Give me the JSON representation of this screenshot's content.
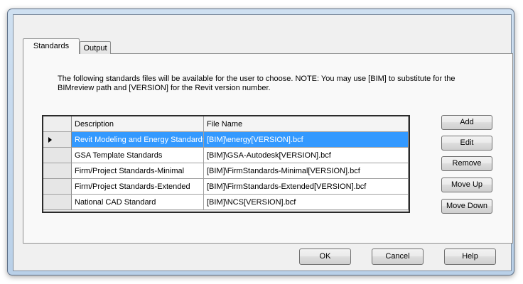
{
  "tabs": [
    {
      "label": "Standards"
    },
    {
      "label": "Output"
    }
  ],
  "note": "The following standards files will be available for the user to choose.  NOTE:  You may use [BIM] to substitute for the BIMreview path and [VERSION] for the Revit version number.",
  "grid": {
    "columns": [
      "Description",
      "File Name"
    ],
    "rows": [
      {
        "description": "Revit Modeling and Energy Standards",
        "file": "[BIM]\\energy[VERSION].bcf",
        "selected": true
      },
      {
        "description": "GSA Template Standards",
        "file": "[BIM]\\GSA-Autodesk[VERSION].bcf",
        "selected": false
      },
      {
        "description": "Firm/Project Standards-Minimal",
        "file": "[BIM]\\FirmStandards-Minimal[VERSION].bcf",
        "selected": false
      },
      {
        "description": "Firm/Project Standards-Extended",
        "file": "[BIM]\\FirmStandards-Extended[VERSION].bcf",
        "selected": false
      },
      {
        "description": "National CAD Standard",
        "file": "[BIM]\\NCS[VERSION].bcf",
        "selected": false
      }
    ]
  },
  "side_buttons": {
    "add": "Add",
    "edit": "Edit",
    "remove": "Remove",
    "move_up": "Move Up",
    "move_down": "Move Down"
  },
  "dialog_buttons": {
    "ok": "OK",
    "cancel": "Cancel",
    "help": "Help"
  },
  "colors": {
    "selection": "#3399ff",
    "dialog_bg": "#f0f0f0",
    "frame": "#b9d0e8"
  }
}
